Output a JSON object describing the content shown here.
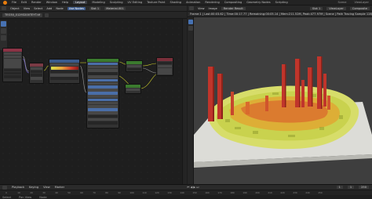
{
  "app": {
    "menus": [
      "File",
      "Edit",
      "Render",
      "Window",
      "Help"
    ],
    "workspaces": [
      "Layout",
      "Modeling",
      "Sculpting",
      "UV Editing",
      "Texture Paint",
      "Shading",
      "Animation",
      "Rendering",
      "Compositing",
      "Geometry Nodes",
      "Scripting"
    ],
    "active_workspace": "Layout",
    "scene_label": "Scene",
    "view_layer_label": "ViewLayer"
  },
  "node_editor": {
    "header_items": [
      "Object",
      "View",
      "Select",
      "Add",
      "Node"
    ],
    "use_nodes": "Use Nodes",
    "slot": "Slot 1",
    "material": "Material.001",
    "image_field": "TEO30_01293200TEYT.tif",
    "colors": {
      "accent": "#4772b3",
      "texture_header": "#7a3a44",
      "input_header": "#8c3346",
      "ramp_header": "#3a5a8c",
      "shader_header": "#3b7a2e",
      "output_header": "#7a2f3a",
      "link_yellow": "#c7c729",
      "link_gray": "#9a9a9a",
      "link_purple": "#7b6bd0"
    }
  },
  "viewport": {
    "editor_type": "Render Result",
    "menu_items": [
      "View",
      "Image"
    ],
    "slot": "Slot 1",
    "view_layer": "ViewLayer",
    "composite": "Composite",
    "render_info": "Frame:1 | Last:00:03.62 | Time:00:17.77 | Remaining:00:05.14 | Mem:211.52M, Peak:477.97M | Scene | Path Tracing Sample 128/128",
    "colors": {
      "bar_high": "#c0352b",
      "terrain_mid": "#e0a832",
      "terrain_low": "#d7dd6a",
      "plane": "#dcdcd7"
    }
  },
  "timeline": {
    "header_items": [
      "Playback",
      "Keying",
      "View",
      "Marker"
    ],
    "frame_ticks": [
      "0",
      "10",
      "20",
      "30",
      "40",
      "50",
      "60",
      "70",
      "80",
      "90",
      "100",
      "110",
      "120",
      "130",
      "140",
      "150",
      "160",
      "170",
      "180",
      "190",
      "200",
      "210",
      "220",
      "230",
      "240",
      "250"
    ],
    "current_frame": "1",
    "start": "1",
    "end": "250",
    "status": [
      "Select",
      "Pan View",
      "Node"
    ]
  }
}
